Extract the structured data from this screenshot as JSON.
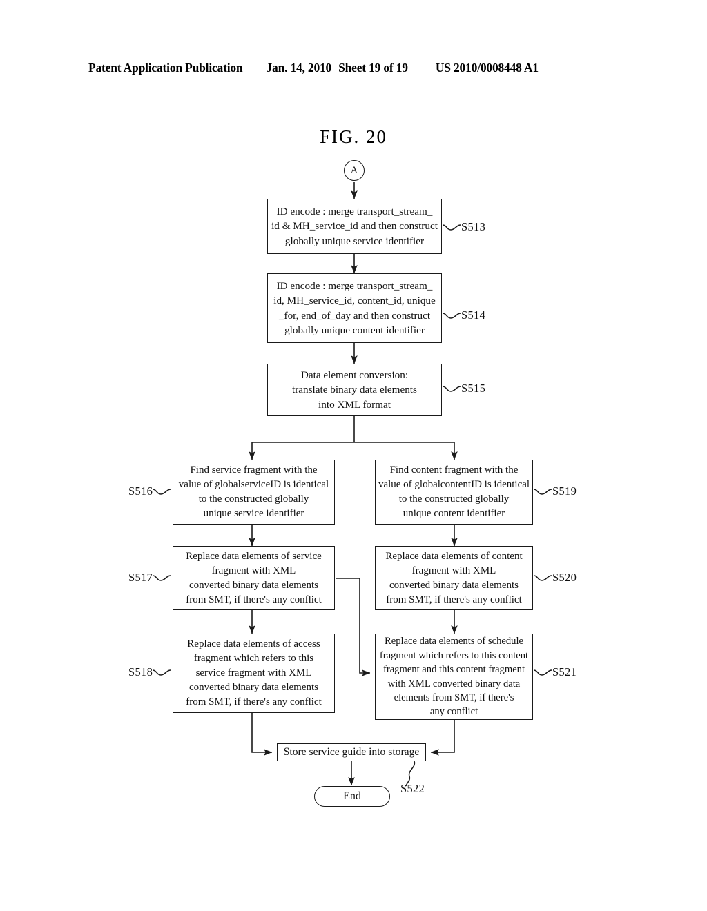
{
  "header": {
    "publication": "Patent Application Publication",
    "date": "Jan. 14, 2010",
    "sheet": "Sheet 19 of 19",
    "patent_number": "US 2010/0008448 A1"
  },
  "figure": {
    "title": "FIG. 20",
    "entry_connector": "A"
  },
  "nodes": {
    "s513": {
      "label": "S513",
      "lines": [
        "ID encode : merge transport_stream_",
        "id & MH_service_id and then construct",
        "globally unique service identifier"
      ]
    },
    "s514": {
      "label": "S514",
      "lines": [
        "ID encode : merge transport_stream_",
        "id, MH_service_id,  content_id, unique",
        "_for, end_of_day and then construct",
        "globally unique content identifier"
      ]
    },
    "s515": {
      "label": "S515",
      "lines": [
        "Data element conversion:",
        "translate binary data elements",
        "into XML format"
      ]
    },
    "s516": {
      "label": "S516",
      "lines": [
        "Find service fragment with the",
        "value of globalserviceID is identical",
        "to the constructed globally",
        "unique service identifier"
      ]
    },
    "s517": {
      "label": "S517",
      "lines": [
        "Replace data elements of service",
        "fragment with XML",
        "converted binary data elements",
        "from SMT, if there's any conflict"
      ]
    },
    "s518": {
      "label": "S518",
      "lines": [
        "Replace data elements of access",
        "fragment which refers to this",
        "service fragment with XML",
        "converted binary data elements",
        "from SMT, if there's any conflict"
      ]
    },
    "s519": {
      "label": "S519",
      "lines": [
        "Find content fragment with the",
        "value of globalcontentID is identical",
        "to the constructed globally",
        "unique content identifier"
      ]
    },
    "s520": {
      "label": "S520",
      "lines": [
        "Replace data elements of content",
        "fragment with XML",
        "converted binary data elements",
        "from SMT, if there's any conflict"
      ]
    },
    "s521": {
      "label": "S521",
      "lines": [
        "Replace data elements of schedule",
        "fragment which refers to this content",
        "fragment and this content fragment",
        "with XML converted binary data",
        "elements from SMT, if there's",
        "any conflict"
      ]
    },
    "s522": {
      "label": "S522",
      "lines": [
        "Store service guide into storage"
      ]
    },
    "end": {
      "lines": [
        "End"
      ]
    }
  },
  "colors": {
    "ink": "#111111",
    "paper": "#ffffff"
  }
}
